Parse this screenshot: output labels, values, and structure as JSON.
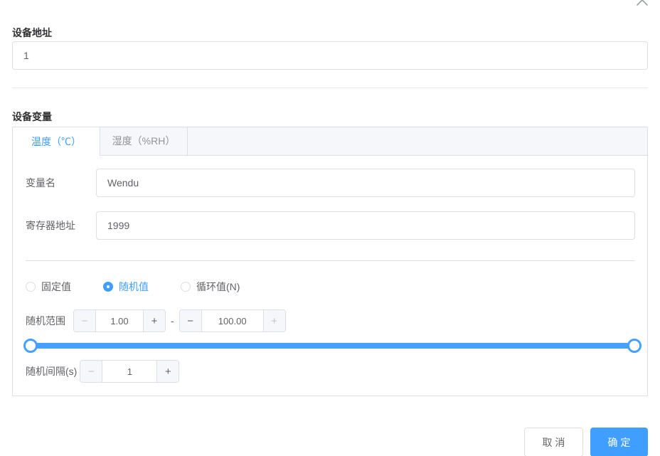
{
  "colors": {
    "accent": "#409EFF",
    "slider_blue": "#46A0FF",
    "border": "#DCDFE6",
    "header_bg": "#F5F7FA"
  },
  "icons": {
    "collapse": "chevron-up",
    "minus": "−",
    "plus": "+"
  },
  "device_address": {
    "label": "设备地址",
    "value": "1"
  },
  "device_variables": {
    "label": "设备变量",
    "tabs": [
      {
        "label": "温度（℃）",
        "active": true
      },
      {
        "label": "湿度（%RH）",
        "active": false
      }
    ],
    "form": {
      "variable_name": {
        "label": "变量名",
        "value": "Wendu"
      },
      "register_address": {
        "label": "寄存器地址",
        "value": "1999"
      },
      "value_type_options": [
        {
          "label": "固定值",
          "selected": false
        },
        {
          "label": "随机值",
          "selected": true
        },
        {
          "label": "循环值(N)",
          "selected": false
        }
      ],
      "random_range": {
        "label": "随机范围",
        "min_value": "1.00",
        "max_value": "100.00",
        "separator": "-"
      },
      "slider": {
        "type": "range",
        "handles_percent": [
          0,
          100
        ]
      },
      "random_interval": {
        "label": "随机间隔(s)",
        "value": "1"
      }
    }
  },
  "footer": {
    "cancel_label": "取 消",
    "confirm_label": "确 定"
  }
}
